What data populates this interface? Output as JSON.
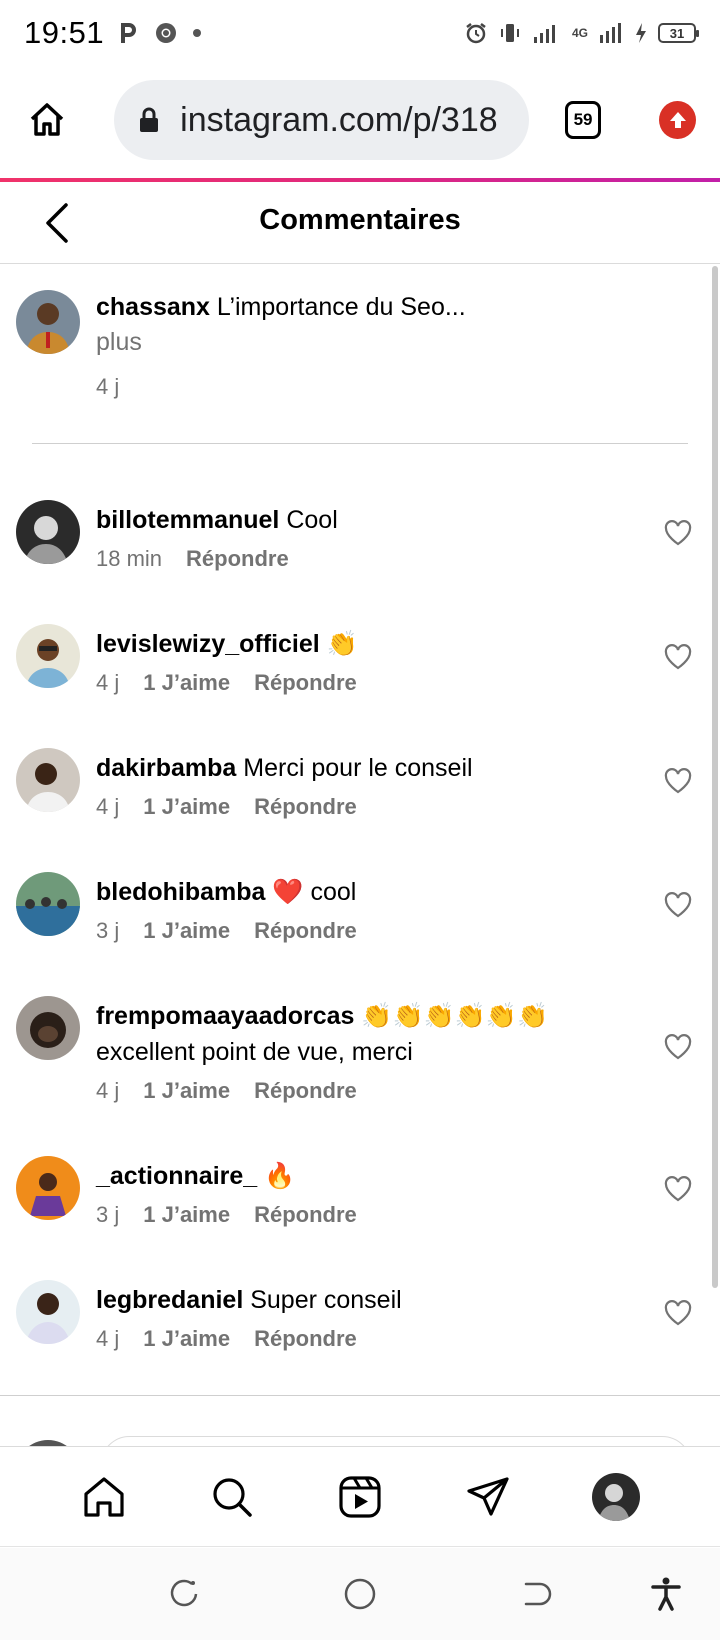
{
  "status_bar": {
    "time": "19:51",
    "network": "4G",
    "battery": "31"
  },
  "browser": {
    "url": "instagram.com/p/318",
    "tab_count": "59"
  },
  "header": {
    "title": "Commentaires"
  },
  "caption": {
    "username": "chassanx",
    "text": "L’importance du Seo...",
    "more": "plus",
    "time": "4 j"
  },
  "comments": [
    {
      "username": "billotemmanuel",
      "text": "Cool",
      "time": "18 min",
      "likes": "",
      "reply": "Répondre"
    },
    {
      "username": "levislewizy_officiel",
      "text": "👏",
      "time": "4 j",
      "likes": "1 J’aime",
      "reply": "Répondre"
    },
    {
      "username": "dakirbamba",
      "text": "Merci pour le conseil",
      "time": "4 j",
      "likes": "1 J’aime",
      "reply": "Répondre"
    },
    {
      "username": "bledohibamba",
      "text": "❤️ cool",
      "time": "3 j",
      "likes": "1 J’aime",
      "reply": "Répondre"
    },
    {
      "username": "frempomaayaadorcas",
      "text": "👏👏👏👏👏👏 excellent point de vue, merci",
      "time": "4 j",
      "likes": "1 J’aime",
      "reply": "Répondre"
    },
    {
      "username": "_actionnaire_",
      "text": "🔥",
      "time": "3 j",
      "likes": "1 J’aime",
      "reply": "Répondre"
    },
    {
      "username": "legbredaniel",
      "text": "Super conseil",
      "time": "4 j",
      "likes": "1 J’aime",
      "reply": "Répondre"
    }
  ],
  "colors": {
    "accent_gradient_start": "#f0326a",
    "accent_gradient_end": "#c21fa8",
    "upgrade": "#d93025",
    "secondary_text": "#737373"
  },
  "icons": {
    "home": "home-icon",
    "lock": "lock-icon",
    "upgrade": "arrow-up-icon",
    "back": "chevron-left-icon",
    "like": "heart-icon",
    "nav": [
      "home-icon",
      "search-icon",
      "reels-icon",
      "send-icon",
      "profile-avatar"
    ]
  }
}
